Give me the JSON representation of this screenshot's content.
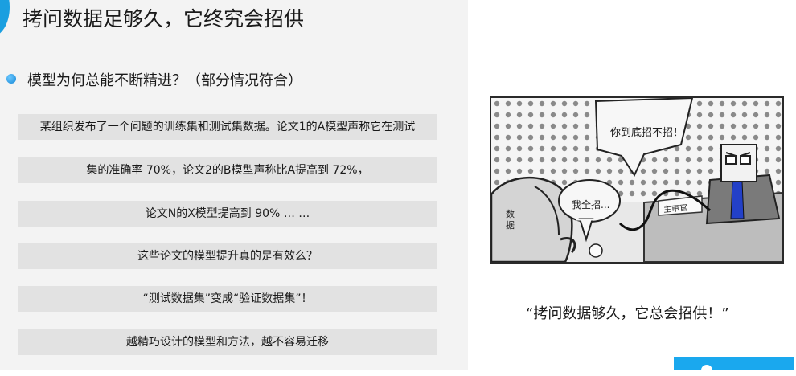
{
  "slide": {
    "title": "拷问数据足够久，它终究会招供",
    "bullet": "模型为何总能不断精进？（部分情况符合）",
    "bars": [
      "某组织发布了一个问题的训练集和测试集数据。论文1的A模型声称它在测试",
      "集的准确率 70%，论文2的B模型声称比A提高到 72%，",
      "论文N的X模型提高到 90% … …",
      "这些论文的模型提升真的是有效么？",
      "“测试数据集”变成“验证数据集”！",
      "越精巧设计的模型和方法，越不容易迁移"
    ]
  },
  "comic": {
    "speech_top": "你到底招不招！",
    "speech_mid": "我全招...",
    "data_label": "数\n据",
    "nameplate": "主审官"
  },
  "caption": "“拷问数据够久，它总会招供！”",
  "colors": {
    "accent": "#1a9fe0",
    "panel_bg": "#f3f3f3",
    "bar_bg": "#e2e2e2",
    "tie": "#2340c8"
  }
}
